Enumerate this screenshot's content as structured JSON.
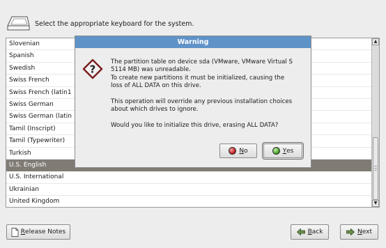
{
  "header": {
    "title": "Select the appropriate keyboard for the system.",
    "icon": "keyboard-key-icon"
  },
  "keyboard_list": {
    "items": [
      "Slovenian",
      "Spanish",
      "Swedish",
      "Swiss French",
      "Swiss French (latin1",
      "Swiss German",
      "Swiss German (latin",
      "Tamil (Inscript)",
      "Tamil (Typewriter)",
      "Turkish",
      "U.S. English",
      "U.S. International",
      "Ukrainian",
      "United Kingdom"
    ],
    "selected": "U.S. English"
  },
  "dialog": {
    "title": "Warning",
    "icon": "question-mark-icon",
    "line1": "The partition table on device sda (VMware, VMware Virtual S",
    "line2": "5114 MB) was unreadable.",
    "line3": "To create new partitions it must be initialized, causing the",
    "line4": "loss of ALL DATA on this drive.",
    "line5": "This operation will override any previous installation choices",
    "line6": "about which drives to ignore.",
    "line7": "Would you like to initialize this drive, erasing ALL DATA?",
    "no_mnemonic": "N",
    "no_rest": "o",
    "yes_mnemonic": "Y",
    "yes_rest": "es"
  },
  "footer": {
    "release_mnemonic": "R",
    "release_rest": "elease Notes",
    "back_mnemonic": "B",
    "back_rest": "ack",
    "next_mnemonic": "N",
    "next_rest": "ext"
  },
  "colors": {
    "dialog_title_bg": "#5f93c8",
    "selected_row_bg": "#807b74",
    "window_bg": "#ededed"
  }
}
